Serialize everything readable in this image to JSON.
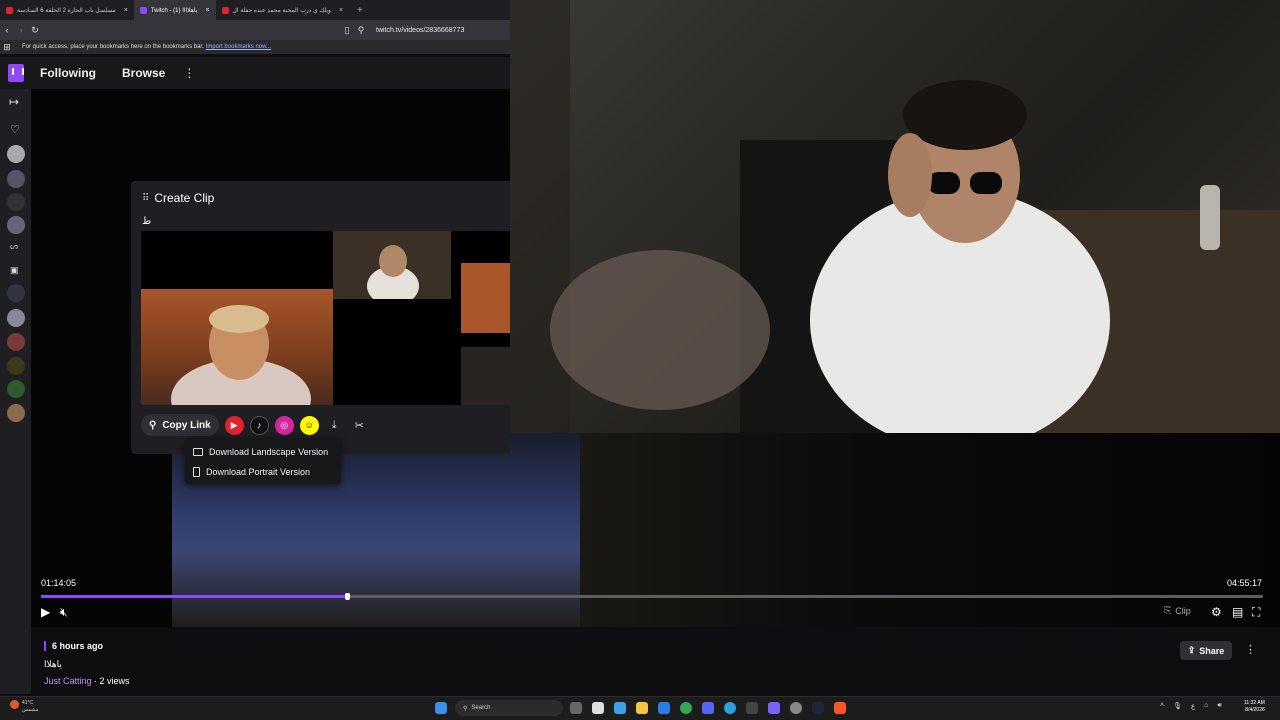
{
  "browser": {
    "tabs": [
      {
        "label": "مسلسل باب الحارة 2 الحلقة 6 السادسة",
        "fav_color": "#e0242c"
      },
      {
        "label": "Twitch - (1) ياهلاااا",
        "fav_color": "#9147ff"
      },
      {
        "label": "ويلك ي درب المحبة محمد عبده حفلة ال",
        "fav_color": "#e0242c"
      }
    ],
    "new_tab": "+",
    "close": "×",
    "url": "twitch.tv/videos/2836668773",
    "bookmarks_text": "For quick access, place your bookmarks here on the bookmarks bar.",
    "bookmarks_link": "Import bookmarks now..."
  },
  "topnav": {
    "following": "Following",
    "browse": "Browse",
    "more": "⋮"
  },
  "clip": {
    "title": "Create Clip",
    "subtitle": "ط",
    "copy_link": "Copy Link",
    "download_menu": {
      "landscape": "Download Landscape Version",
      "portrait": "Download Portrait Version"
    }
  },
  "player": {
    "current_time": "01:14:05",
    "duration": "04:55:17",
    "progress": 0.25,
    "clip_label": "Clip"
  },
  "video_info": {
    "time_ago": "6 hours ago",
    "title": "ياهلاا",
    "category": "Just Catting",
    "views": " · 2 views",
    "share": "Share",
    "more": "⋮"
  },
  "taskbar": {
    "temperature": "41°C",
    "weather_desc": "مشمس",
    "search": "Search",
    "time": "11:32 AM",
    "date": "8/4/2026",
    "lang": "ع"
  },
  "colors": {
    "accent": "#9147ff",
    "youtube": "#e0242c",
    "tiktok": "#111111",
    "instagram": "#d6249f",
    "snapchat": "#fffc00"
  }
}
